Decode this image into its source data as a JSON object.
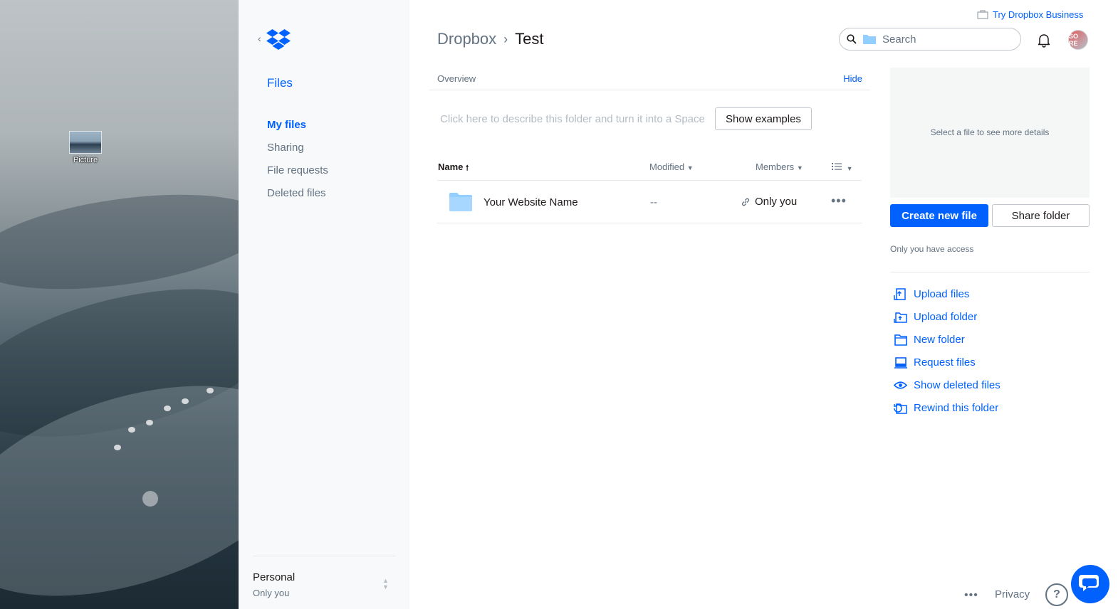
{
  "desktop": {
    "icon_label": "Picture"
  },
  "nav": {
    "section_title": "Files",
    "items": [
      {
        "label": "My files",
        "active": true
      },
      {
        "label": "Sharing",
        "active": false
      },
      {
        "label": "File requests",
        "active": false
      },
      {
        "label": "Deleted files",
        "active": false
      }
    ],
    "account": {
      "name": "Personal",
      "subtitle": "Only you"
    }
  },
  "header": {
    "try_business": "Try Dropbox Business",
    "breadcrumb": {
      "root": "Dropbox",
      "separator": "›",
      "current": "Test"
    },
    "search_placeholder": "Search",
    "avatar_initials": "SO RE"
  },
  "overview": {
    "label": "Overview",
    "hide_label": "Hide",
    "describe_text": "Click here to describe this folder and turn it into a Space",
    "show_examples_label": "Show examples"
  },
  "table": {
    "columns": {
      "name": "Name",
      "modified": "Modified",
      "members": "Members"
    },
    "rows": [
      {
        "name": "Your Website Name",
        "modified": "--",
        "members": "Only you"
      }
    ]
  },
  "details_panel": {
    "placeholder": "Select a file to see more details",
    "create_label": "Create new file",
    "share_label": "Share folder",
    "access_text": "Only you have access",
    "actions": [
      {
        "label": "Upload files",
        "icon": "upload-file-icon"
      },
      {
        "label": "Upload folder",
        "icon": "upload-folder-icon"
      },
      {
        "label": "New folder",
        "icon": "new-folder-icon"
      },
      {
        "label": "Request files",
        "icon": "request-files-icon"
      },
      {
        "label": "Show deleted files",
        "icon": "eye-icon"
      },
      {
        "label": "Rewind this folder",
        "icon": "rewind-icon"
      }
    ]
  },
  "footer": {
    "more": "•••",
    "privacy": "Privacy",
    "help": "?"
  },
  "colors": {
    "accent": "#0061fe",
    "text_secondary": "#637282",
    "folder": "#92ceff"
  }
}
